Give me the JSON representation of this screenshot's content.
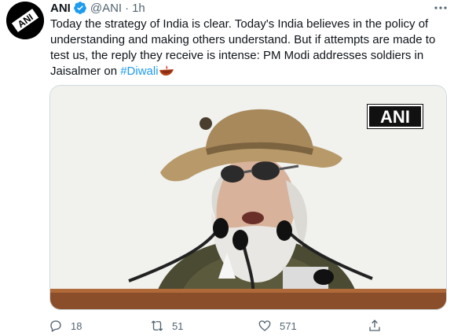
{
  "tweet": {
    "author_name": "ANI",
    "handle": "@ANI",
    "separator": "·",
    "time": "1h",
    "text_main": "Today the strategy of India is clear. Today's India believes in the policy of understanding and making others understand. But if attempts are made to test us, the reply they receive is intense: PM Modi addresses soldiers in Jaisalmer on ",
    "hashtag": "#Diwali"
  },
  "media": {
    "watermark_text": "ANI"
  },
  "actions": {
    "replies": "18",
    "retweets": "51",
    "likes": "571"
  },
  "colors": {
    "accent": "#1d9bf0",
    "text": "#0f1419",
    "muted": "#536471"
  },
  "icons": [
    "ani-logo-icon",
    "verified-badge-icon",
    "more-icon",
    "diya-emoji-icon",
    "reply-icon",
    "retweet-icon",
    "like-icon",
    "share-icon"
  ]
}
